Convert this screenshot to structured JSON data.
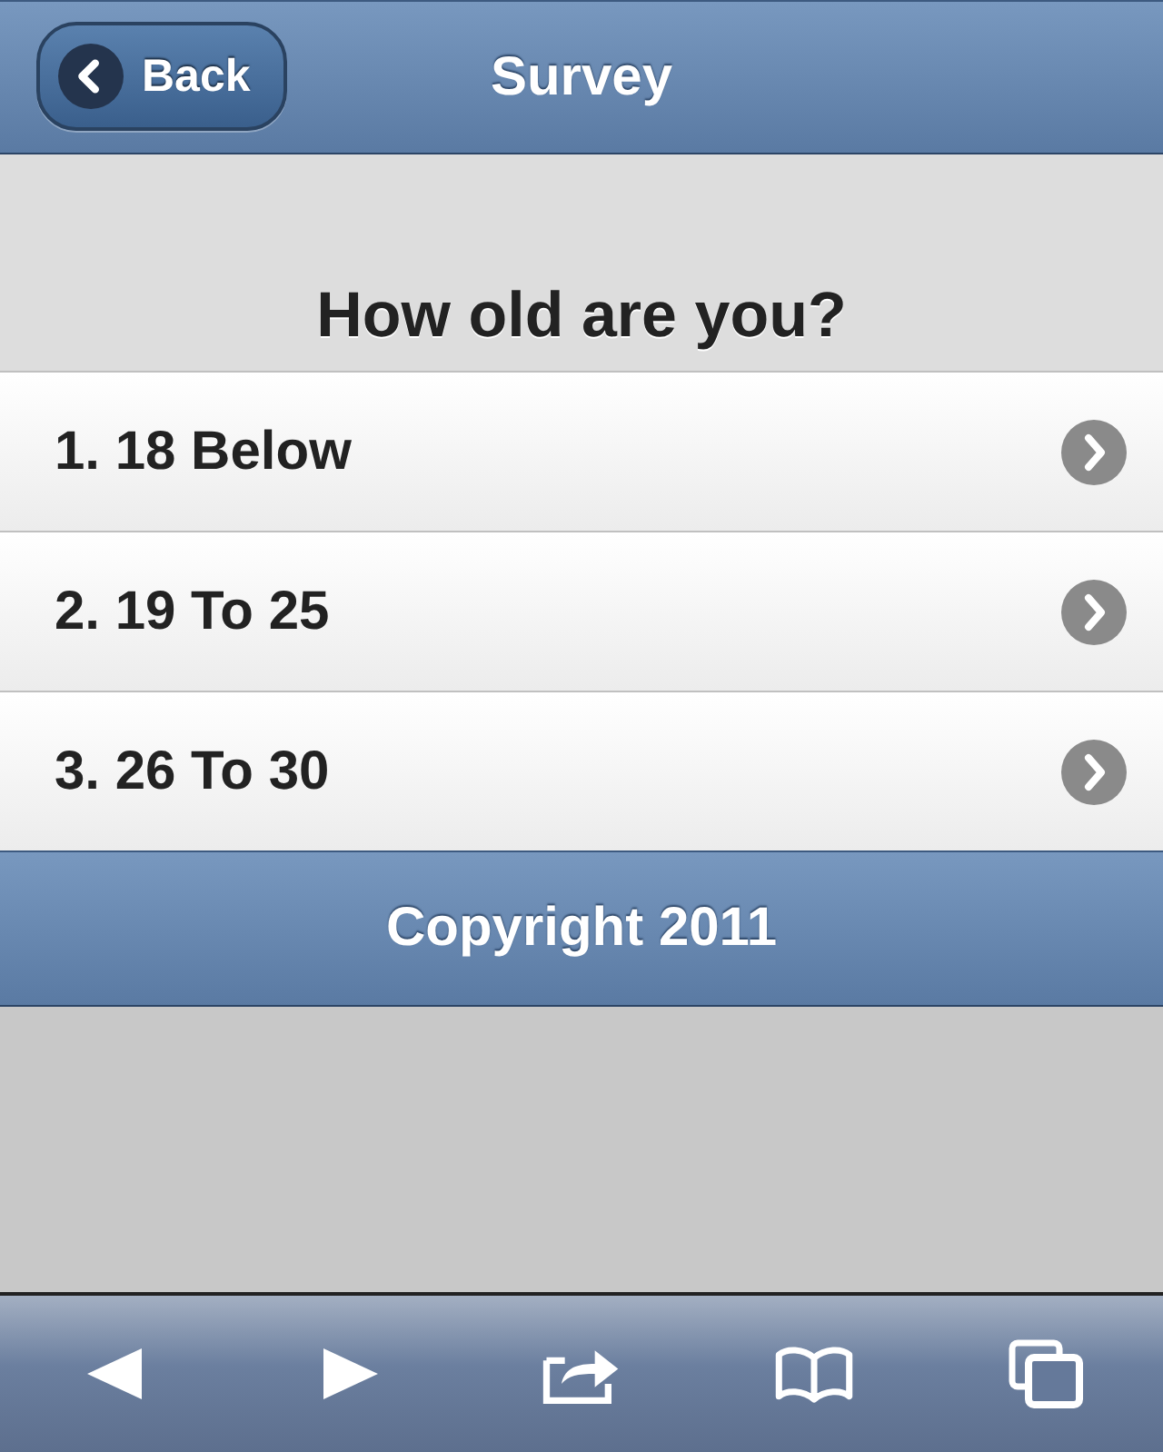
{
  "header": {
    "back_button": "Back",
    "title": "Survey"
  },
  "question": "How old are you?",
  "options": [
    {
      "label": "1. 18 Below"
    },
    {
      "label": "2. 19 To 25"
    },
    {
      "label": "3. 26 To 30"
    }
  ],
  "footer": {
    "text": "Copyright 2011"
  }
}
